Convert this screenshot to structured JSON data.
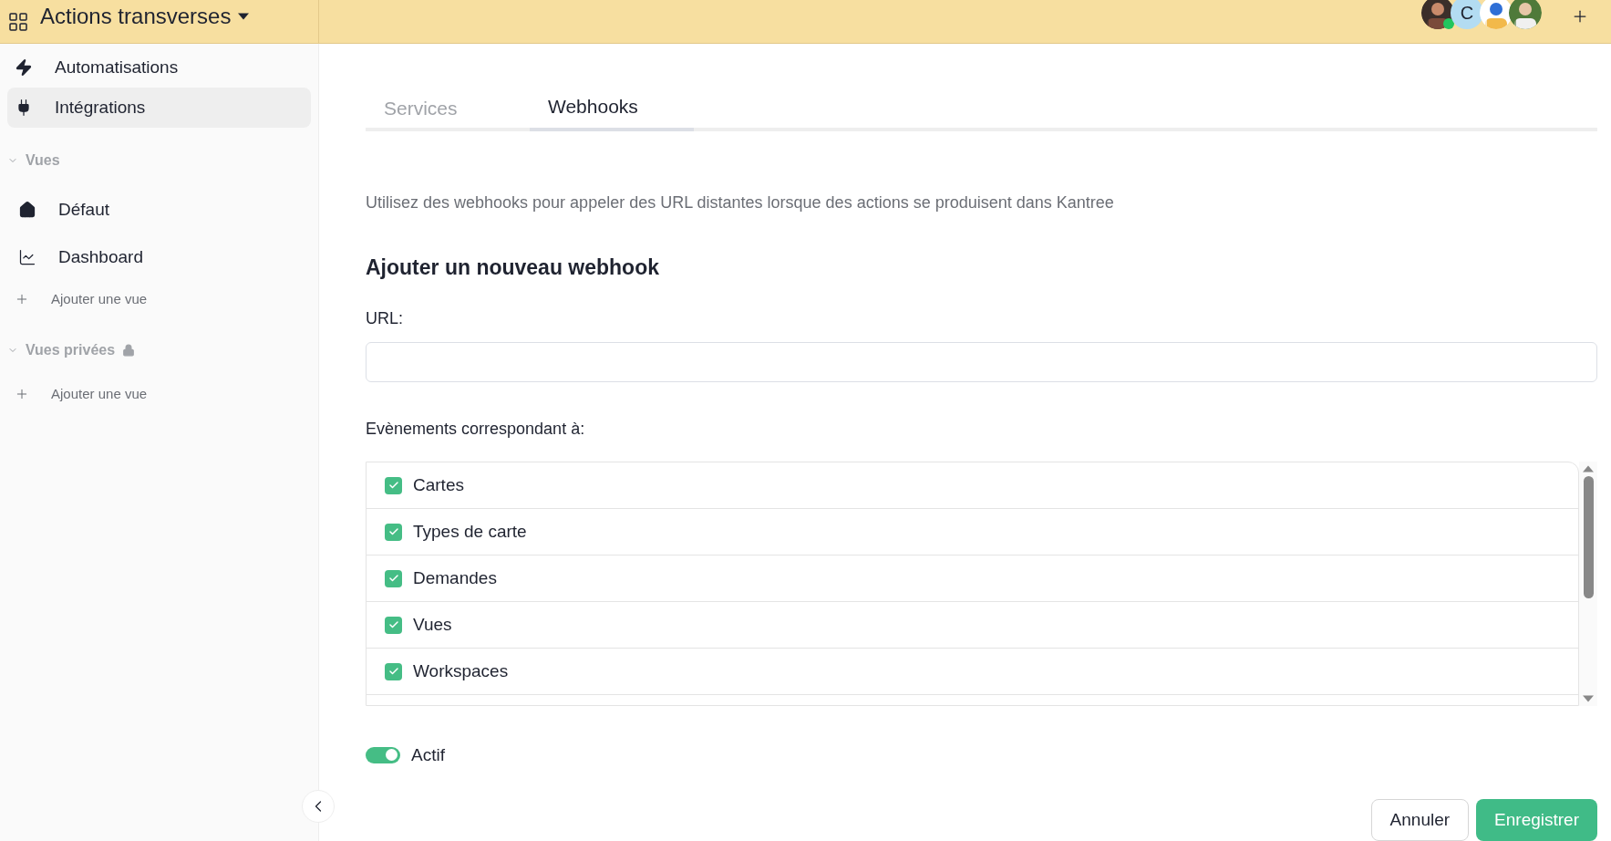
{
  "header": {
    "title": "Actions transverses",
    "avatars": [
      {
        "kind": "picture",
        "online": true
      },
      {
        "kind": "initial",
        "initial": "C",
        "online": false
      },
      {
        "kind": "picture",
        "online": false
      },
      {
        "kind": "picture",
        "online": false
      }
    ]
  },
  "sidebar": {
    "items": [
      {
        "kind": "bolt",
        "label": "Automatisations",
        "selected": false
      },
      {
        "kind": "plug",
        "label": "Intégrations",
        "selected": true
      }
    ],
    "sections": [
      {
        "title": "Vues",
        "expanded": true,
        "locked": false,
        "items": [
          {
            "kind": "home",
            "label": "Défaut"
          },
          {
            "kind": "chart",
            "label": "Dashboard"
          }
        ],
        "add_label": "Ajouter une vue"
      },
      {
        "title": "Vues privées",
        "expanded": true,
        "locked": true,
        "add_label": "Ajouter une vue"
      }
    ]
  },
  "tabs": [
    {
      "label": "Services",
      "selected": false
    },
    {
      "label": "Webhooks",
      "selected": true
    }
  ],
  "description": "Utilisez des webhooks pour appeler des URL distantes lorsque des actions se produisent dans Kantree",
  "heading": "Ajouter un nouveau webhook",
  "url": {
    "label": "URL:"
  },
  "events": {
    "label": "Evènements correspondant à:",
    "items": [
      {
        "label": "Cartes",
        "checked": true
      },
      {
        "label": "Types de carte",
        "checked": true
      },
      {
        "label": "Demandes",
        "checked": true
      },
      {
        "label": "Vues",
        "checked": true
      },
      {
        "label": "Workspaces",
        "checked": true
      }
    ]
  },
  "active": {
    "label": "Actif",
    "on": true
  },
  "buttons": {
    "cancel": "Annuler",
    "save": "Enregistrer"
  }
}
